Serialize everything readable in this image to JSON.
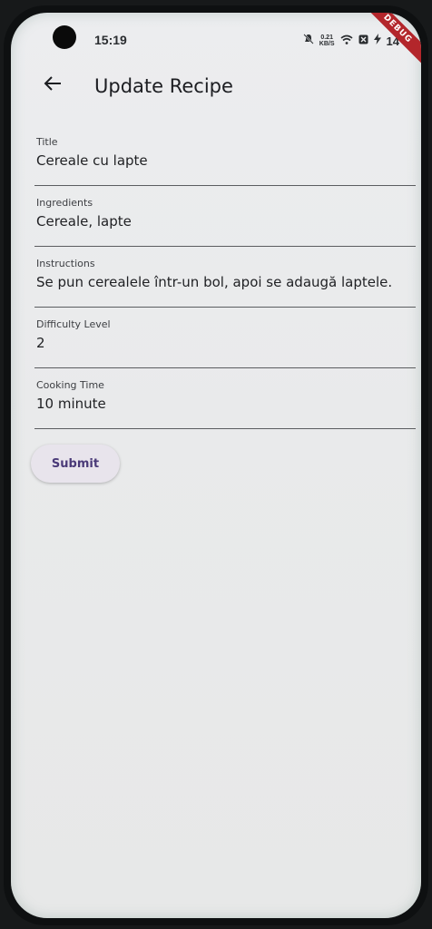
{
  "status_bar": {
    "time": "15:19",
    "network_speed_value": "0.21",
    "network_speed_unit": "KB/S",
    "battery_level": "14",
    "debug_banner": "DEBUG"
  },
  "app_bar": {
    "title": "Update Recipe"
  },
  "form": {
    "fields": [
      {
        "label": "Title",
        "value": "Cereale cu lapte"
      },
      {
        "label": "Ingredients",
        "value": "Cereale, lapte"
      },
      {
        "label": "Instructions",
        "value": "Se pun cerealele într-un bol, apoi se adaugă laptele."
      },
      {
        "label": "Difficulty Level",
        "value": "2"
      },
      {
        "label": "Cooking Time",
        "value": "10 minute"
      }
    ],
    "submit_label": "Submit"
  },
  "colors": {
    "background": "#e9eaeb",
    "text_primary": "#1c1d21",
    "button_text": "#4a3a78",
    "debug_ribbon": "#b3262b"
  }
}
